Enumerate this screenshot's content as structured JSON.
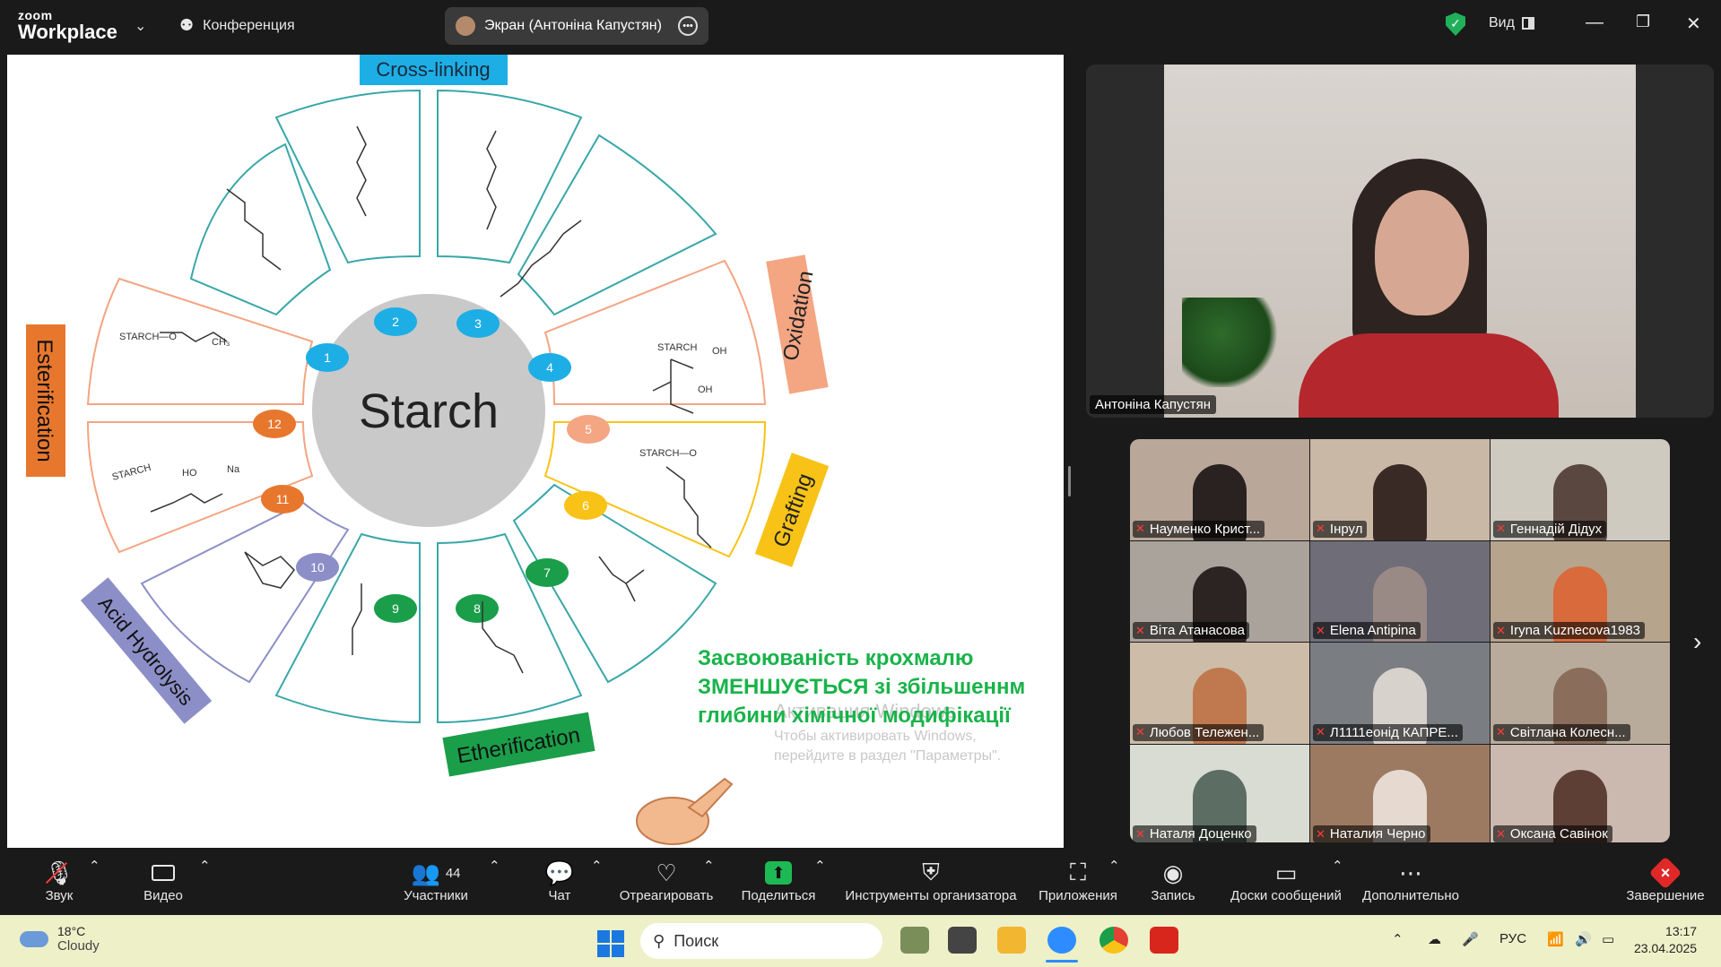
{
  "app": {
    "logo_top": "zoom",
    "logo_bottom": "Workplace",
    "meeting_label": "Конференция",
    "screen_share_label": "Экран (Антоніна Капустян)",
    "view_label": "Вид"
  },
  "slide": {
    "center_label": "Starch",
    "categories": {
      "cross_linking": "Cross-linking",
      "oxidation": "Oxidation",
      "grafting": "Grafting",
      "etherification": "Etherification",
      "acid_hydrolysis": "Acid Hydrolysis",
      "esterification": "Esterification"
    },
    "segments": [
      {
        "num": "1",
        "color": "#1eaee6"
      },
      {
        "num": "2",
        "color": "#1eaee6"
      },
      {
        "num": "3",
        "color": "#1eaee6"
      },
      {
        "num": "4",
        "color": "#1eaee6"
      },
      {
        "num": "5",
        "color": "#f4a582"
      },
      {
        "num": "6",
        "color": "#f8c316"
      },
      {
        "num": "7",
        "color": "#1a9e4a"
      },
      {
        "num": "8",
        "color": "#1a9e4a"
      },
      {
        "num": "9",
        "color": "#1a9e4a"
      },
      {
        "num": "10",
        "color": "#8c8fc7"
      },
      {
        "num": "11",
        "color": "#e8772e"
      },
      {
        "num": "12",
        "color": "#e8772e"
      }
    ],
    "formulas": {
      "f5_a": "STARCH",
      "f5_b": "OH",
      "f5_c": "OH",
      "f6": "STARCH—O",
      "f12_a": "STARCH—O",
      "f12_b": "CH₃",
      "f11_a": "STARCH",
      "f11_b": "HO",
      "f11_c": "Na"
    },
    "note_line1": "Засвоюваність крохмалю",
    "note_line2": "ЗМЕНШУЄТЬСЯ зі збільшеннм",
    "note_line3": "глибини хімічної модифікації",
    "watermark_line1": "Активация Windows",
    "watermark_line2": "Чтобы активировать Windows,",
    "watermark_line3": "перейдите в раздел \"Параметры\"."
  },
  "speaker": {
    "name": "Антоніна Капустян"
  },
  "participants": [
    {
      "name": "Науменко Крист...",
      "bg": "#b9a799",
      "fg": "#2a2220"
    },
    {
      "name": "Інрул",
      "bg": "#c9b8a6",
      "fg": "#3a2a26"
    },
    {
      "name": "Геннадій Дідух",
      "bg": "#cfcac0",
      "fg": "#5a4840"
    },
    {
      "name": "Віта Атанасова",
      "bg": "#a9a39c",
      "fg": "#2b2422"
    },
    {
      "name": "Elena Antipina",
      "bg": "#6f6e78",
      "fg": "#9a8a86"
    },
    {
      "name": "Iryna Kuznecova1983",
      "bg": "#b7a48d",
      "fg": "#d96a3b"
    },
    {
      "name": "Любов Тележен...",
      "bg": "#cdbca8",
      "fg": "#c0794f"
    },
    {
      "name": "Л1111еонід КАПРЕ...",
      "bg": "#7a7d82",
      "fg": "#d8d2cc"
    },
    {
      "name": "Світлана Колесн...",
      "bg": "#b8ab9b",
      "fg": "#8a6d5a"
    },
    {
      "name": "Наталя Доценко",
      "bg": "#d9dcd2",
      "fg": "#5c6d63"
    },
    {
      "name": "Наталия Черно",
      "bg": "#9c7a62",
      "fg": "#e6d9d0"
    },
    {
      "name": "Оксана Савінок",
      "bg": "#cbb9b0",
      "fg": "#5e3f36"
    }
  ],
  "toolbar": {
    "audio": "Звук",
    "video": "Видео",
    "participants": "Участники",
    "participants_count": "44",
    "chat": "Чат",
    "react": "Отреагировать",
    "share": "Поделиться",
    "host_tools": "Инструменты организатора",
    "apps": "Приложения",
    "record": "Запись",
    "whiteboards": "Доски сообщений",
    "more": "Дополнительно",
    "end": "Завершение"
  },
  "taskbar": {
    "temperature": "18°C",
    "weather": "Cloudy",
    "search_placeholder": "Поиск",
    "language": "РУС",
    "time": "13:17",
    "date": "23.04.2025"
  }
}
